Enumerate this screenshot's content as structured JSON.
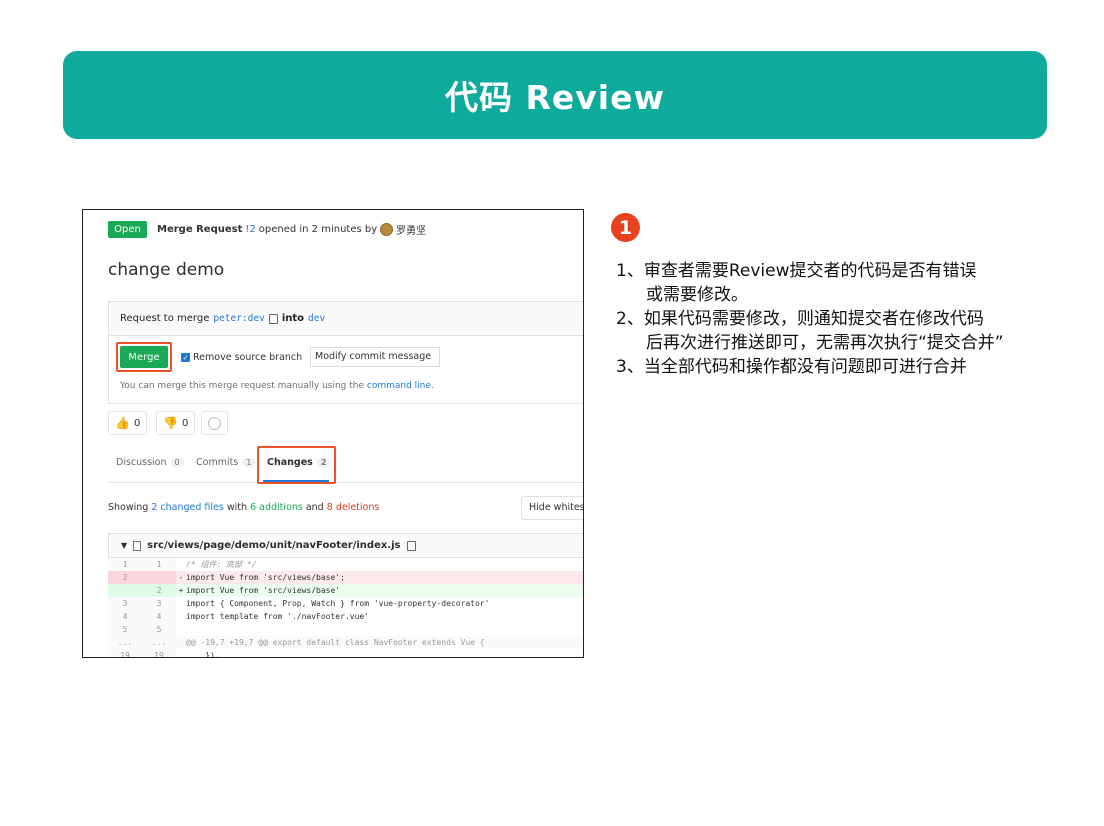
{
  "banner": {
    "title": "代码 Review"
  },
  "screenshot": {
    "status_badge": "Open",
    "mr_label": "Merge Request",
    "mr_id": "!2",
    "opened_text": "opened in 2 minutes by",
    "author": "罗勇坚",
    "title": "change demo",
    "request_prefix": "Request to merge",
    "source_branch": "peter:dev",
    "into_text": "into",
    "target_branch": "dev",
    "merge_button": "Merge",
    "remove_source_branch": "Remove source branch",
    "commit_message_button": "Modify commit message",
    "manual_note": "You can merge this merge request manually using the",
    "command_line_link": "command line",
    "manual_note_end": ".",
    "thumbs_up_count": "0",
    "thumbs_down_count": "0",
    "tabs": [
      {
        "label": "Discussion",
        "count": "0"
      },
      {
        "label": "Commits",
        "count": "1"
      },
      {
        "label": "Changes",
        "count": "2"
      }
    ],
    "showing": {
      "prefix": "Showing",
      "files": "2 changed files",
      "with": "with",
      "additions": "6 additions",
      "and": "and",
      "deletions": "8 deletions"
    },
    "hide_whitespace": "Hide whitespace changes",
    "file_path": "src/views/page/demo/unit/navFooter/index.js",
    "diff_lines": [
      {
        "type": "ctx",
        "old": "1",
        "new": "1",
        "sign": "",
        "code": "/* 组件: 底部 */"
      },
      {
        "type": "del",
        "old": "2",
        "new": "",
        "sign": "-",
        "code": "import Vue from 'src/views/base';"
      },
      {
        "type": "add",
        "old": "",
        "new": "2",
        "sign": "+",
        "code": "import Vue from 'src/views/base'"
      },
      {
        "type": "ctx",
        "old": "3",
        "new": "3",
        "sign": "",
        "code": "import { Component, Prop, Watch } from 'vue-property-decorator'"
      },
      {
        "type": "ctx",
        "old": "4",
        "new": "4",
        "sign": "",
        "code": "import template from './navFooter.vue'"
      },
      {
        "type": "ctx",
        "old": "5",
        "new": "5",
        "sign": "",
        "code": ""
      },
      {
        "type": "meta",
        "old": "...",
        "new": "...",
        "sign": "",
        "code": "@@ -19,7 +19,7 @@ export default class NavFooter extends Vue {"
      },
      {
        "type": "ctx",
        "old": "19",
        "new": "19",
        "sign": "",
        "code": "    }),"
      }
    ]
  },
  "right": {
    "badge": "1",
    "steps": [
      {
        "line1": "1、审查者需要Review提交者的代码是否有错误",
        "line2": "或需要修改。"
      },
      {
        "line1": "2、如果代码需要修改，则通知提交者在修改代码",
        "line2": "后再次进行推送即可，无需再次执行“提交合并”"
      },
      {
        "line1": "3、当全部代码和操作都没有问题即可进行合并",
        "line2": ""
      }
    ]
  },
  "colors": {
    "banner": "#0eaa9c",
    "accent_red": "#e8411f",
    "gitlab_green": "#1aaa55",
    "link_blue": "#1f78d1"
  }
}
